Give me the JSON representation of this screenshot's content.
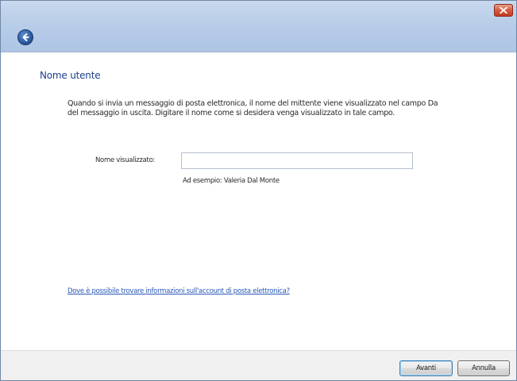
{
  "window": {
    "title": "",
    "close_icon": "close-icon",
    "back_icon": "back-arrow-icon"
  },
  "page": {
    "heading": "Nome utente",
    "description": "Quando si invia un messaggio di posta elettronica, il nome del mittente viene visualizzato nel campo Da del messaggio in uscita. Digitare il nome come si desidera venga visualizzato in tale campo."
  },
  "form": {
    "display_name_label": "Nome visualizzato:",
    "display_name_value": "",
    "display_name_example": "Ad esempio: Valeria Dal Monte"
  },
  "help": {
    "link_text": "Dove è possibile trovare informazioni sull'account di posta elettronica?"
  },
  "buttons": {
    "next_label": "Avanti",
    "cancel_label": "Annulla"
  },
  "colors": {
    "heading": "#1e3e8e",
    "link": "#2a58b6",
    "close_button": "#c23b22",
    "titlebar": "#b8cde8"
  }
}
